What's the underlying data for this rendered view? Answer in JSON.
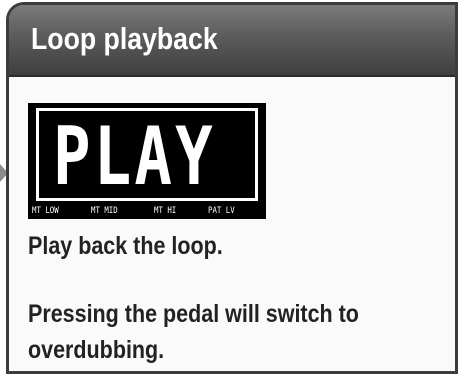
{
  "panel": {
    "title": "Loop playback"
  },
  "display": {
    "text": "PLAY",
    "labels": [
      "MT LOW",
      "MT MID",
      "MT HI",
      "PAT LV"
    ]
  },
  "description": {
    "line1": "Play back the loop.",
    "line2a": "Pressing the pedal will switch to",
    "line2b": "overdubbing."
  },
  "colors": {
    "header_gradient_top": "#7a7a7a",
    "header_gradient_bottom": "#3f3f3f",
    "border": "#3c3c3c",
    "display_background": "#000000",
    "display_foreground": "#ffffff"
  }
}
